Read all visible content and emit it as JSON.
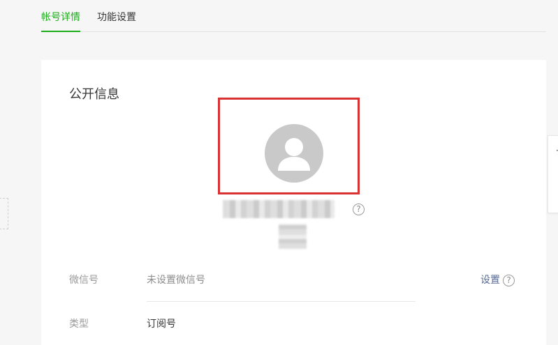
{
  "tabs": [
    {
      "label": "帐号详情",
      "active": true
    },
    {
      "label": "功能设置",
      "active": false
    }
  ],
  "card": {
    "title": "公开信息"
  },
  "profile": {
    "help_symbol": "?"
  },
  "rows": {
    "wechat_id": {
      "label": "微信号",
      "value": "未设置微信号",
      "action": "设置",
      "help_symbol": "?"
    },
    "type": {
      "label": "类型",
      "value": "订阅号"
    }
  },
  "colors": {
    "accent": "#1aad19",
    "link": "#576b95",
    "highlight_box": "#d93232",
    "avatar_bg": "#c9c9c9"
  }
}
